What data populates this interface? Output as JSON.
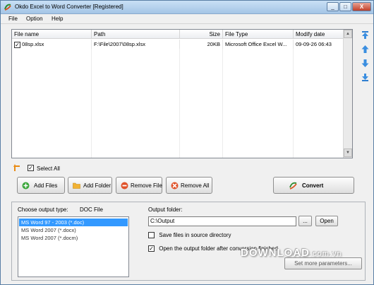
{
  "window": {
    "title": "Okdo Excel to Word Converter [Registered]",
    "minimize": "_",
    "maximize": "□",
    "close": "X"
  },
  "menu": [
    "File",
    "Option",
    "Help"
  ],
  "grid": {
    "columns": [
      "File name",
      "Path",
      "Size",
      "File Type",
      "Modify date"
    ],
    "rows": [
      {
        "checked": true,
        "name": "08sp.xlsx",
        "path": "F:\\File\\2007\\08sp.xlsx",
        "size": "20KB",
        "type": "Microsoft Office Excel W...",
        "date": "09-09-26 06:43"
      }
    ]
  },
  "select_all_label": "Select All",
  "buttons": {
    "add_files": "Add Files",
    "add_folder": "Add Folder",
    "remove_file": "Remove File",
    "remove_all": "Remove All",
    "convert": "Convert"
  },
  "output": {
    "type_label": "Choose output type:",
    "type_value": "DOC File",
    "formats": [
      "MS Word 97 - 2003 (*.doc)",
      "MS Word 2007 (*.docx)",
      "MS Word 2007 (*.docm)"
    ],
    "selected_index": 0,
    "folder_label": "Output folder:",
    "folder_value": "C:\\Output",
    "browse": "...",
    "open": "Open",
    "save_in_source": "Save files in source directory",
    "save_in_source_checked": false,
    "open_after": "Open the output folder after conversion finished",
    "open_after_checked": true,
    "set_params": "Set more parameters..."
  },
  "watermark": {
    "main": "DOWNLOAD",
    "suffix": ".com.vn"
  },
  "colors": {
    "selection": "#3399ff",
    "accent": "#2f6ebd"
  }
}
